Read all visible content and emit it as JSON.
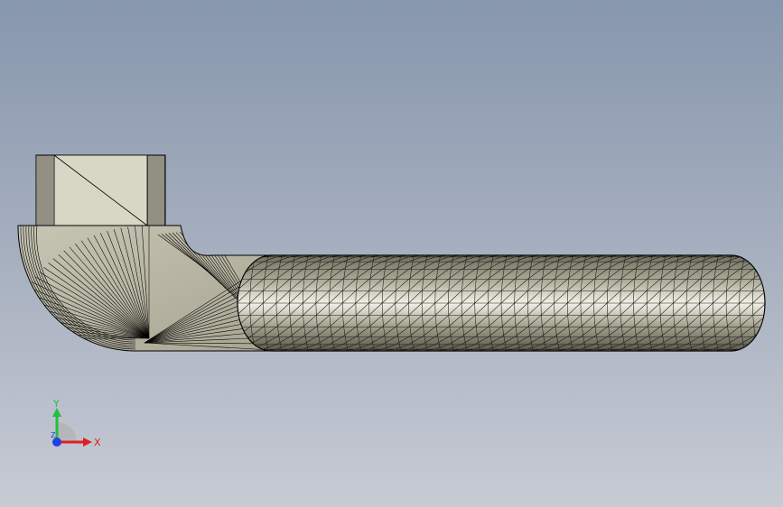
{
  "viewport": {
    "background_top": "#8797ad",
    "background_bottom": "#c7cbd4"
  },
  "model": {
    "shading": "shaded-with-edges-mesh",
    "fill_color": "#b4b29f",
    "edge_color": "#000000",
    "highlight_color": "#f2f1e8"
  },
  "triad": {
    "x_label": "X",
    "y_label": "Y",
    "z_label": "Z",
    "x_color": "#e02020",
    "y_color": "#20c040",
    "z_color": "#2040e0"
  }
}
